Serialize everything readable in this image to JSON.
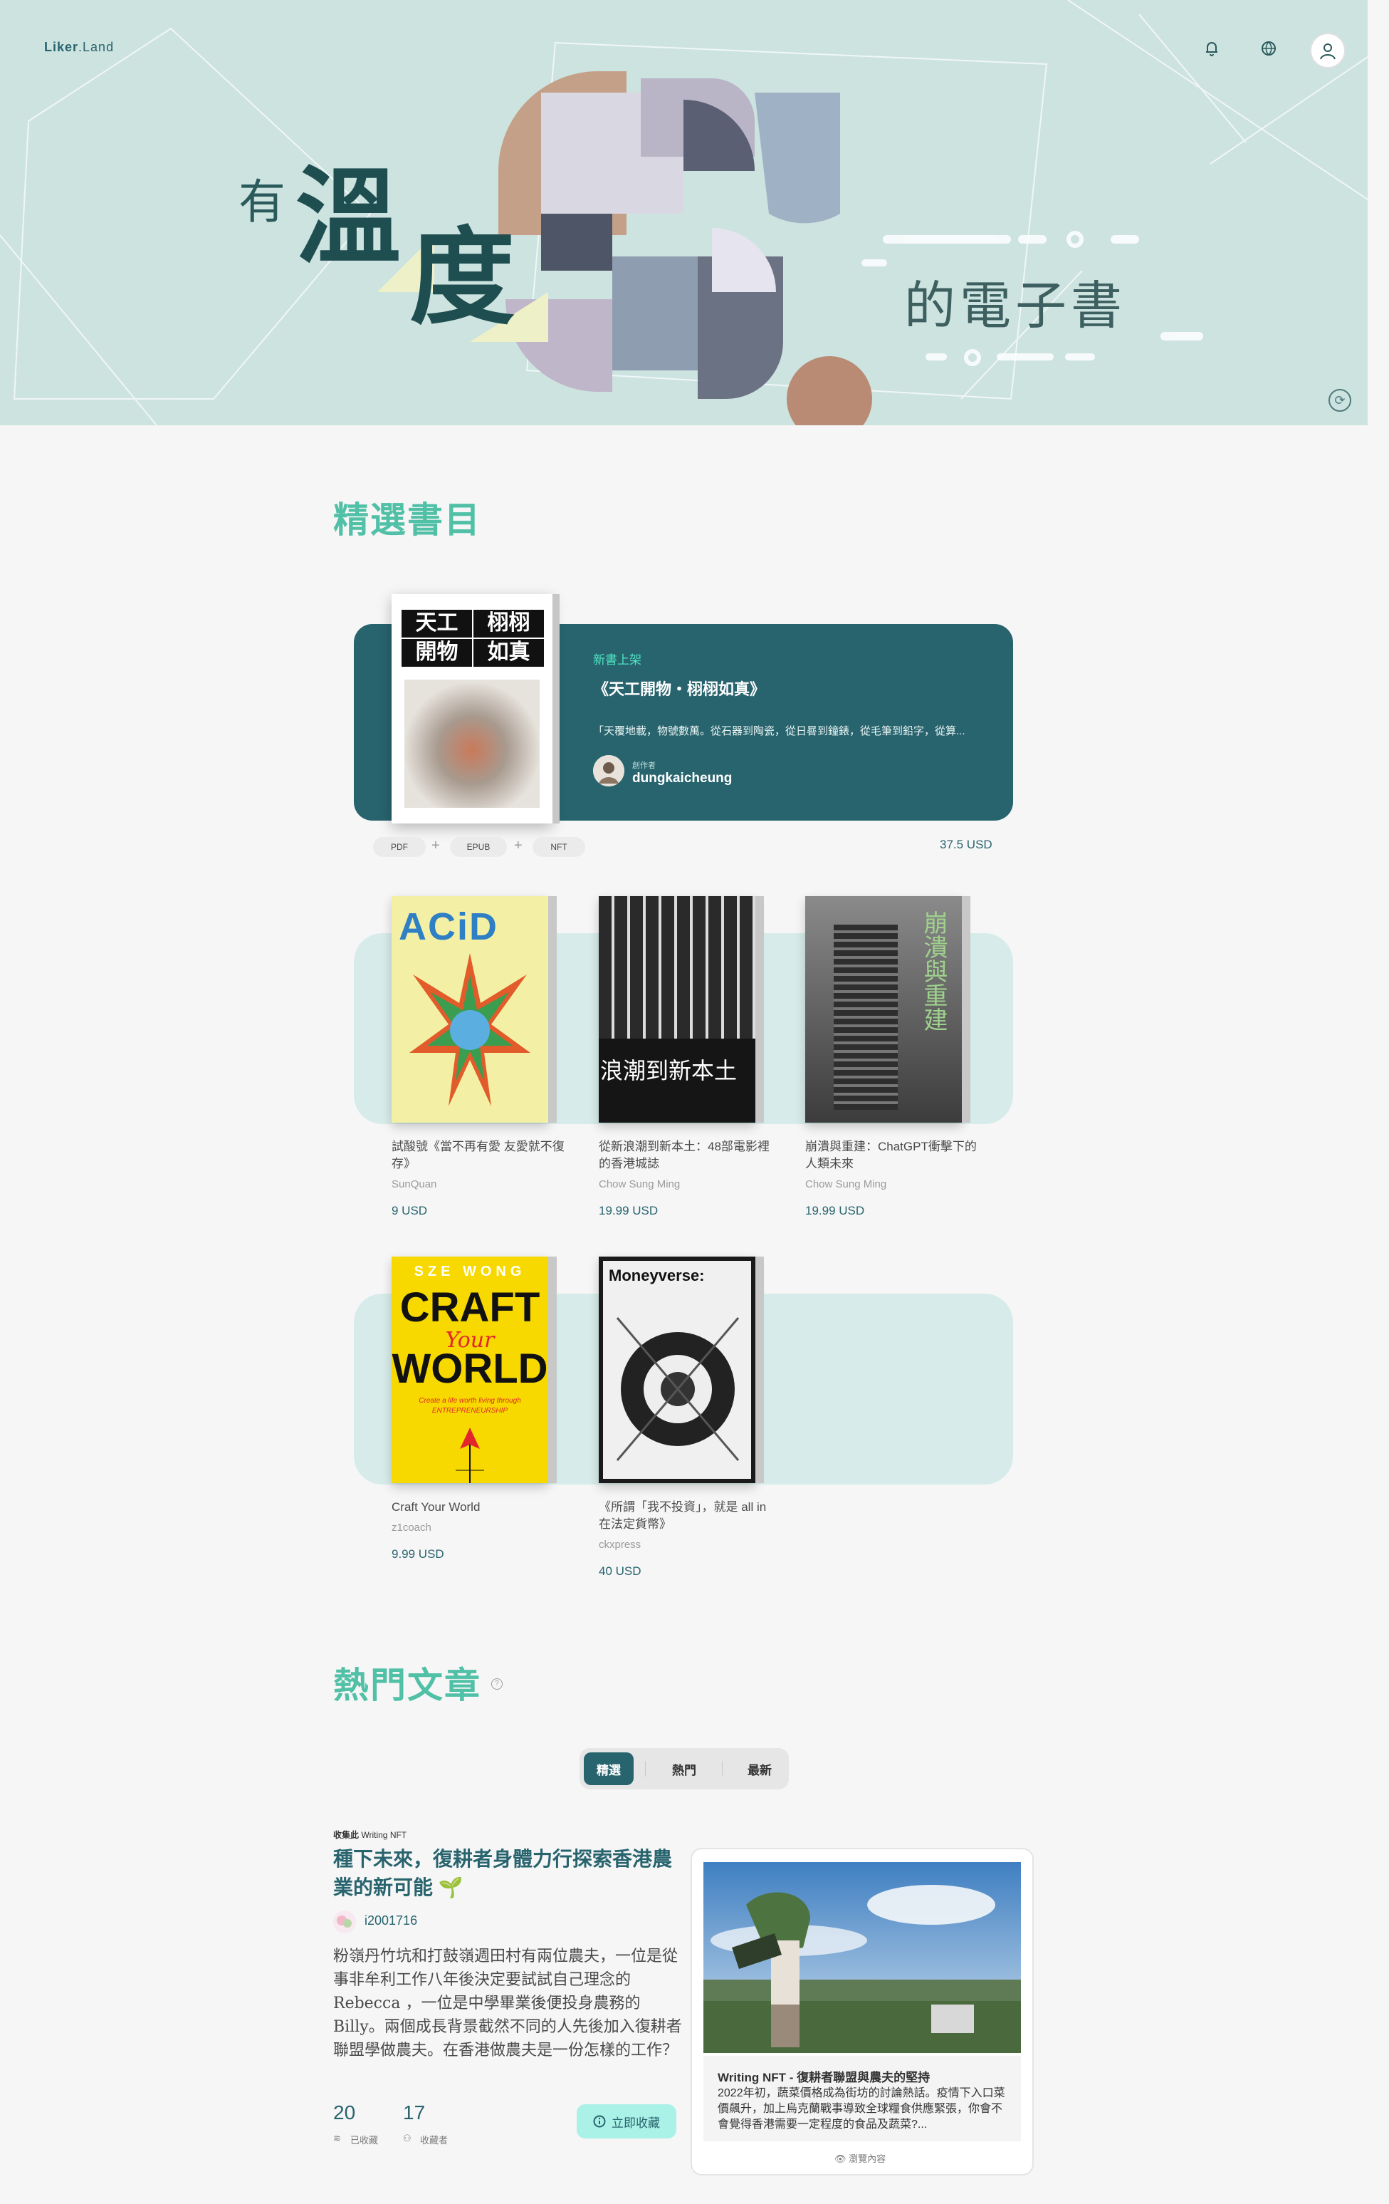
{
  "header": {
    "logo_main": "Liker",
    "logo_sub": ".Land",
    "icons": [
      "bell-icon",
      "globe-icon",
      "user-icon"
    ]
  },
  "hero": {
    "title_small": "有",
    "title_big_1": "溫",
    "title_big_2": "度",
    "subtitle": "的電子書"
  },
  "featured_section": {
    "title": "精選書目",
    "featured": {
      "tag": "新書上架",
      "title": "《天工開物・栩栩如真》",
      "cover_text": [
        "天工",
        "栩栩",
        "開物",
        "如真"
      ],
      "description": "「天覆地載，物號數萬。從石器到陶瓷，從日晷到鐘錶，從毛筆到鉛字，從算...",
      "author_label": "創作者",
      "author": "dungkaicheung",
      "formats": [
        "PDF",
        "EPUB",
        "NFT"
      ],
      "price": "37.5 USD"
    },
    "books": [
      {
        "title": "試酸號《當不再有愛 友愛就不復存》",
        "author": "SunQuan",
        "price": "9 USD",
        "cover_text": "ACiD"
      },
      {
        "title": "從新浪潮到新本土：48部電影裡的香港城誌",
        "author": "Chow Sung Ming",
        "price": "19.99 USD",
        "cover_text": "浪潮到新本土"
      },
      {
        "title": "崩潰與重建：ChatGPT衝擊下的人類未來",
        "author": "Chow Sung Ming",
        "price": "19.99 USD",
        "cover_text": "崩潰與重建"
      },
      {
        "title": "Craft Your World",
        "author": "z1coach",
        "price": "9.99 USD",
        "cover_author": "SZE WONG",
        "cover_line1": "CRAFT",
        "cover_line2": "Your",
        "cover_line3": "WORLD",
        "cover_sub": "Create a life worth living through ENTREPRENEURSHIP"
      },
      {
        "title": "《所謂「我不投資」，就是 all in 在法定貨幣》",
        "author": "ckxpress",
        "price": "40 USD",
        "cover_text": "Moneyverse:"
      }
    ]
  },
  "articles_section": {
    "title": "熱門文章",
    "tabs": [
      "精選",
      "熱門",
      "最新"
    ],
    "active_tab": 0,
    "article": {
      "collection_label": "收集此",
      "collection_name": "Writing NFT",
      "title": "種下未來，復耕者身體力行探索香港農業的新可能 🌱",
      "user": "i2001716",
      "body": "粉嶺丹竹坑和打鼓嶺週田村有兩位農夫，一位是從事非牟利工作八年後決定要試試自己理念的Rebecca ，一位是中學畢業後便投身農務的Billy。兩個成長背景截然不同的人先後加入復耕者聯盟學做農夫。在香港做農夫是一份怎樣的工作？",
      "collected_count": "20",
      "collected_label": "已收藏",
      "collectors_count": "17",
      "collectors_label": "收藏者",
      "collect_button": "立即收藏",
      "card_title": "Writing NFT - 復耕者聯盟與農夫的堅持",
      "card_desc": "2022年初，蔬菜價格成為街坊的討論熱話。疫情下入口菜價飆升，加上烏克蘭戰事導致全球糧食供應緊張，你會不會覺得香港需要一定程度的食品及蔬菜?...",
      "card_view": "瀏覽內容"
    }
  },
  "colors": {
    "accent": "#28646e",
    "mint": "#50e3c2",
    "title_green": "#50c0a6",
    "hero_bg": "#cde3e0"
  }
}
